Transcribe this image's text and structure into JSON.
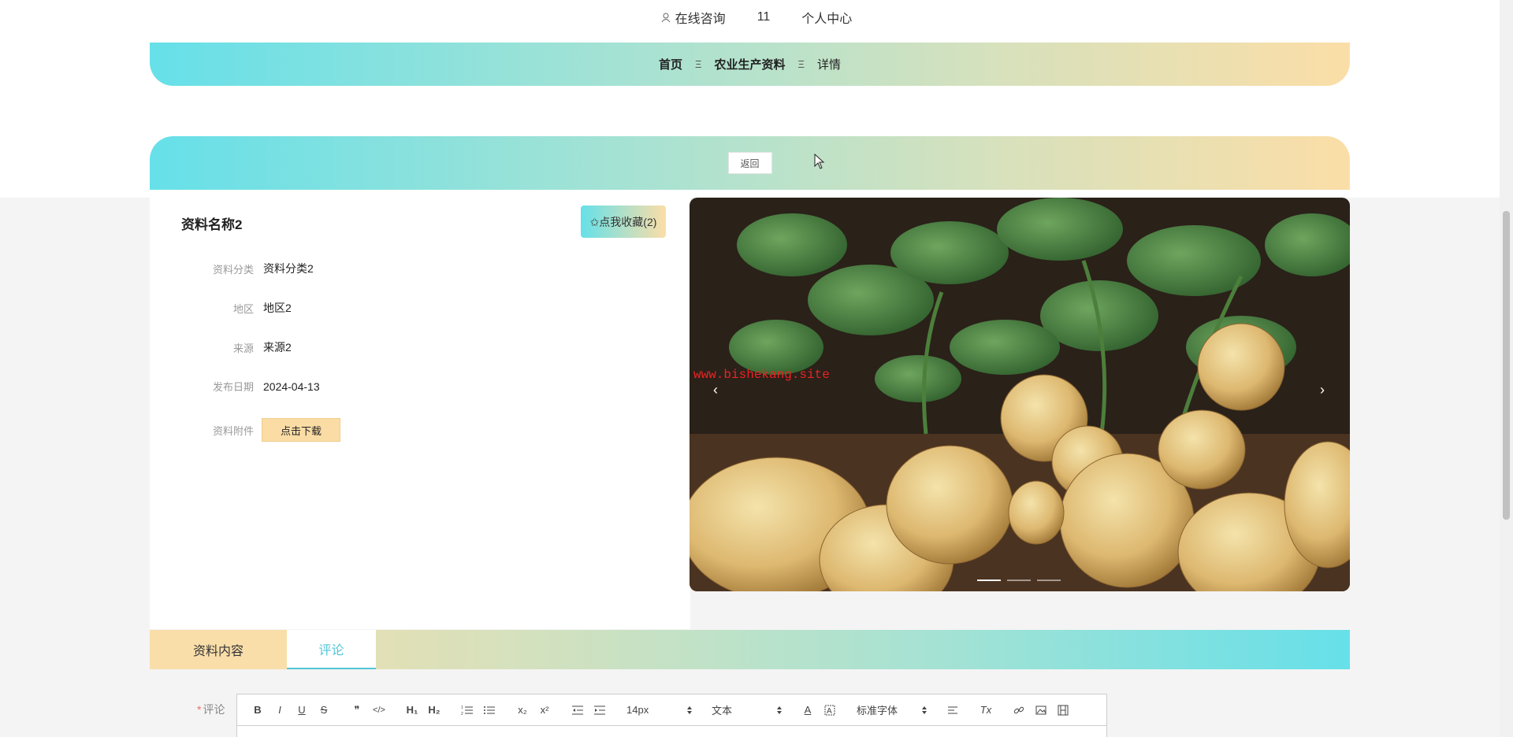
{
  "topbar": {
    "consult_label": "在线咨询",
    "username": "11",
    "center_label": "个人中心"
  },
  "breadcrumb": {
    "home": "首页",
    "category": "农业生产资料",
    "current": "详情",
    "separator": "Ξ"
  },
  "back_label": "返回",
  "detail": {
    "title": "资料名称2",
    "favorite_label": "✩点我收藏(2)",
    "fields": [
      {
        "label": "资料分类",
        "value": "资料分类2"
      },
      {
        "label": "地区",
        "value": "地区2"
      },
      {
        "label": "来源",
        "value": "来源2"
      },
      {
        "label": "发布日期",
        "value": "2024-04-13"
      }
    ],
    "attachment_label": "资料附件",
    "download_label": "点击下载"
  },
  "carousel": {
    "watermark": "www.bishekang.site",
    "prev": "‹",
    "next": "›",
    "slide_count": 3,
    "active_slide": 1
  },
  "tabs": {
    "content_label": "资料内容",
    "comment_label": "评论"
  },
  "comment": {
    "required_mark": "*",
    "label": "评论"
  },
  "editor": {
    "bold": "B",
    "italic": "I",
    "underline": "U",
    "strike": "S",
    "quote": "❞",
    "code": "</>",
    "h1": "H₁",
    "h2": "H₂",
    "subscript": "x₂",
    "superscript": "x²",
    "font_size": "14px",
    "paragraph": "文本",
    "font_family": "标准字体",
    "font_color": "A",
    "clean": "Tx"
  },
  "colors": {
    "accent": "#4fc6d9",
    "gradient_start": "#66e0e9",
    "gradient_end": "#fbdea7"
  }
}
